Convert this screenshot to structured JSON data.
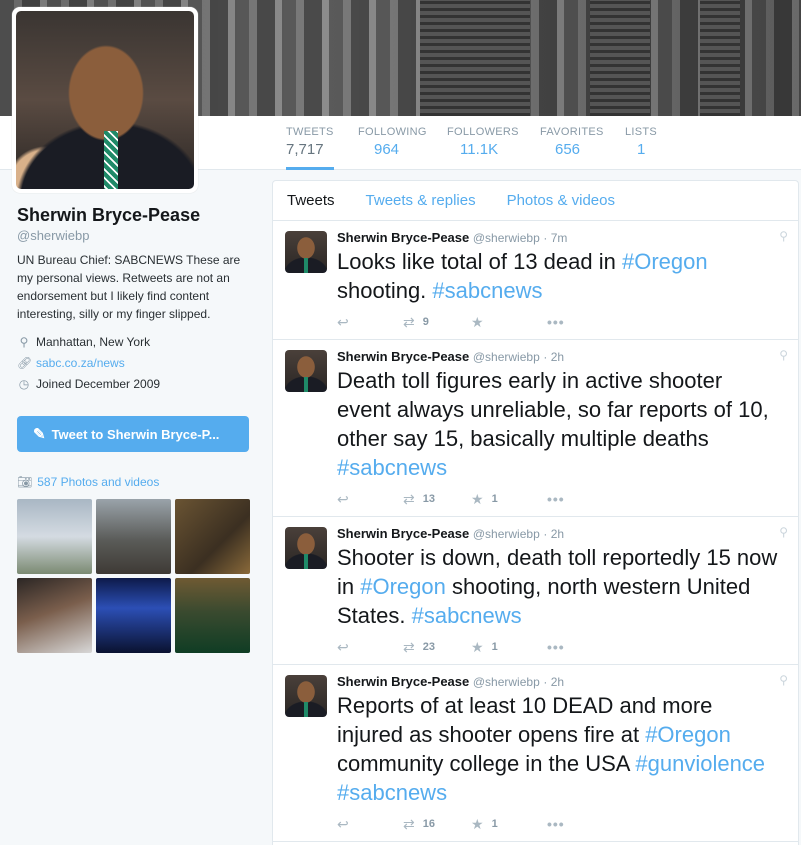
{
  "profile": {
    "name": "Sherwin Bryce-Pease",
    "handle": "@sherwiebp",
    "bio": "UN Bureau Chief: SABCNEWS These are my personal views. Retweets are not an endorsement but I likely find content interesting, silly or my finger slipped.",
    "location": "Manhattan, New York",
    "website": "sabc.co.za/news",
    "joined": "Joined December 2009",
    "tweet_to_label": "Tweet to Sherwin Bryce-P...",
    "photos_label": "587 Photos and videos"
  },
  "stats": [
    {
      "label": "TWEETS",
      "value": "7,717"
    },
    {
      "label": "FOLLOWING",
      "value": "964"
    },
    {
      "label": "FOLLOWERS",
      "value": "11.1K"
    },
    {
      "label": "FAVORITES",
      "value": "656"
    },
    {
      "label": "LISTS",
      "value": "1"
    }
  ],
  "tabs": [
    "Tweets",
    "Tweets & replies",
    "Photos & videos"
  ],
  "tweets": [
    {
      "name": "Sherwin Bryce-Pease",
      "handle": "@sherwiebp",
      "time": "· 7m",
      "text_parts": [
        [
          "Looks like total of 13 dead in ",
          false
        ],
        [
          "#Oregon",
          true
        ],
        [
          " shooting. ",
          false
        ],
        [
          "#sabcnews",
          true
        ]
      ],
      "retweets": "9",
      "favorites": ""
    },
    {
      "name": "Sherwin Bryce-Pease",
      "handle": "@sherwiebp",
      "time": "· 2h",
      "text_parts": [
        [
          "Death toll figures early in active shooter event always unreliable, so far reports of 10, other say 15, basically multiple deaths ",
          false
        ],
        [
          "#sabcnews",
          true
        ]
      ],
      "retweets": "13",
      "favorites": "1"
    },
    {
      "name": "Sherwin Bryce-Pease",
      "handle": "@sherwiebp",
      "time": "· 2h",
      "text_parts": [
        [
          "Shooter is down, death toll reportedly 15 now in ",
          false
        ],
        [
          "#Oregon",
          true
        ],
        [
          " shooting, north western United States. ",
          false
        ],
        [
          "#sabcnews",
          true
        ]
      ],
      "retweets": "23",
      "favorites": "1"
    },
    {
      "name": "Sherwin Bryce-Pease",
      "handle": "@sherwiebp",
      "time": "· 2h",
      "text_parts": [
        [
          "Reports of at least 10 DEAD and more injured as shooter opens fire at ",
          false
        ],
        [
          "#Oregon",
          true
        ],
        [
          " community college in the USA ",
          false
        ],
        [
          "#gunviolence",
          true
        ],
        [
          " ",
          false
        ],
        [
          "#sabcnews",
          true
        ]
      ],
      "retweets": "16",
      "favorites": "1"
    }
  ],
  "colors": {
    "accent": "#55acee",
    "text": "#14171a",
    "muted": "#8899a6"
  }
}
